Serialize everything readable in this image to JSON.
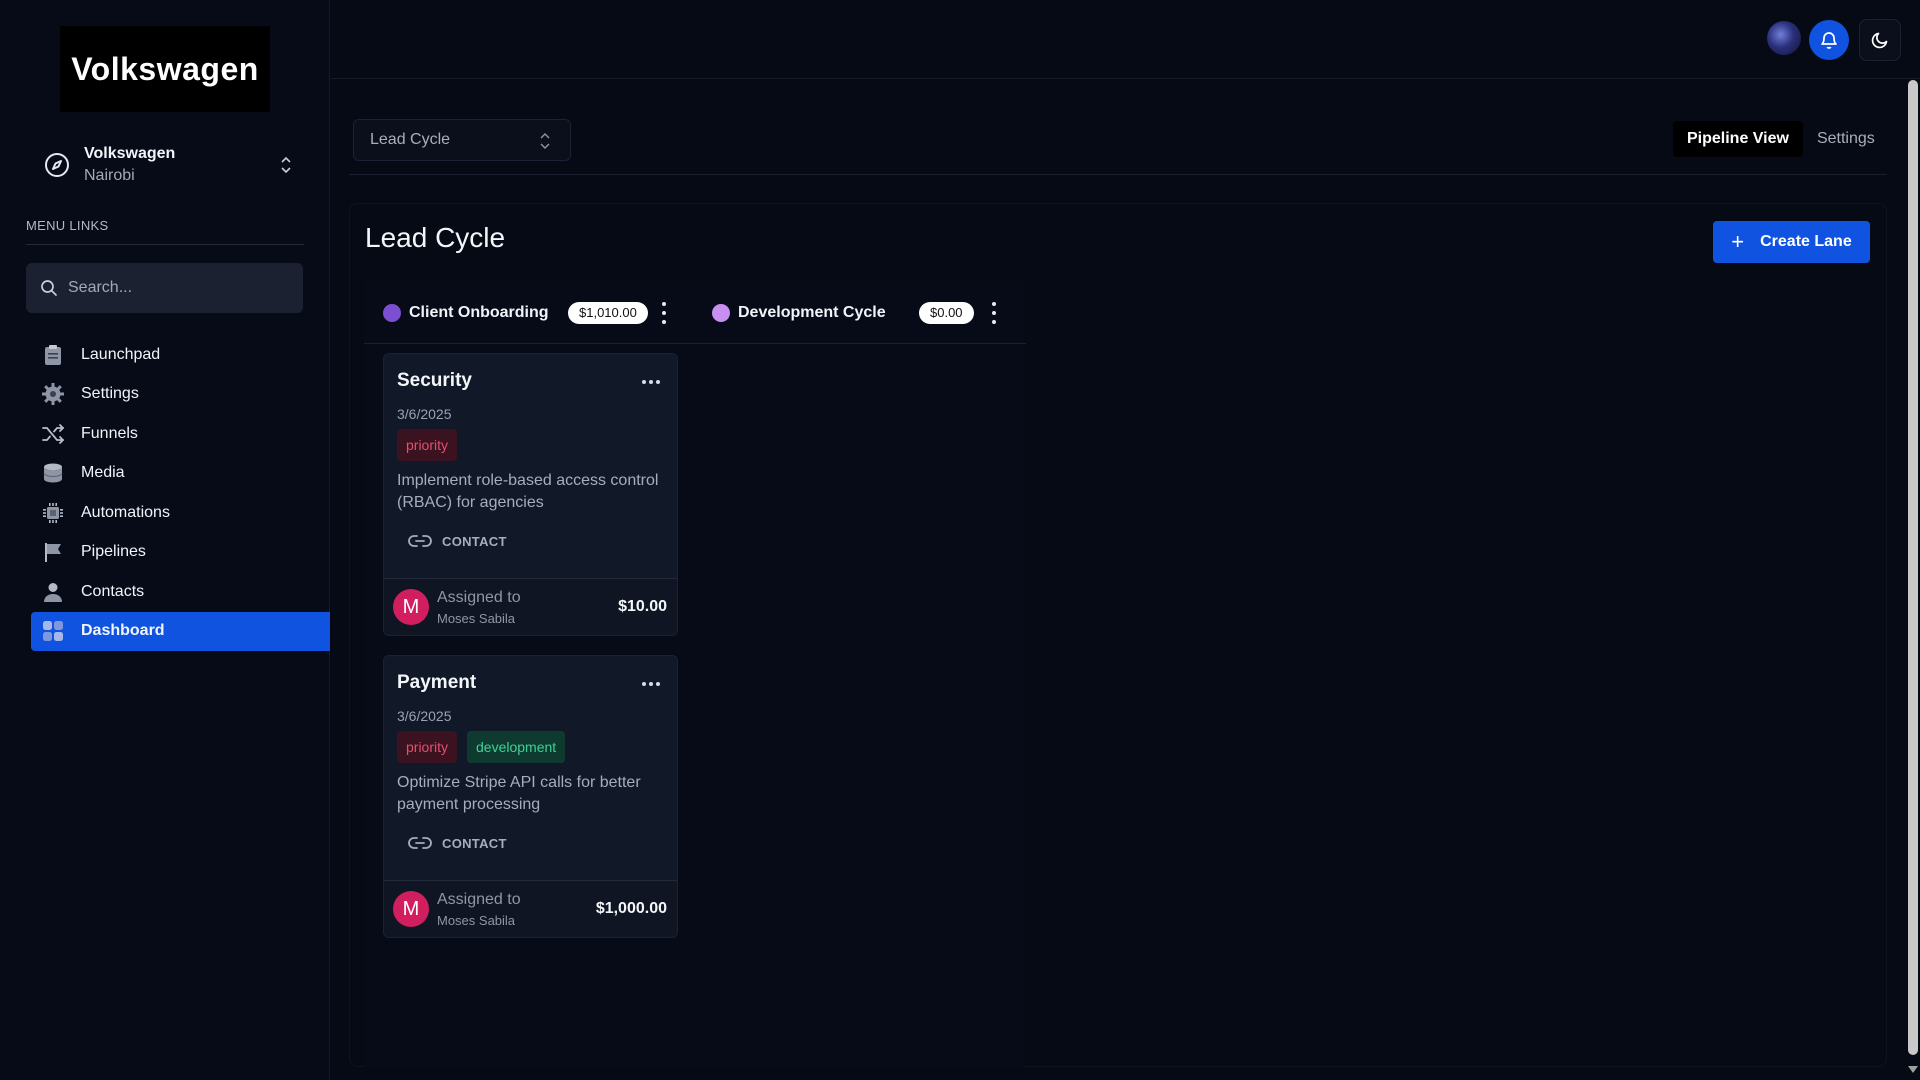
{
  "brand": {
    "logo_text": "Volkswagen"
  },
  "agency": {
    "name": "Volkswagen",
    "location": "Nairobi"
  },
  "sidebar": {
    "menu_title": "MENU LINKS",
    "search_placeholder": "Search...",
    "items": [
      {
        "label": "Launchpad",
        "icon": "clipboard-icon"
      },
      {
        "label": "Settings",
        "icon": "gear-icon"
      },
      {
        "label": "Funnels",
        "icon": "shuffle-icon"
      },
      {
        "label": "Media",
        "icon": "database-icon"
      },
      {
        "label": "Automations",
        "icon": "chip-icon"
      },
      {
        "label": "Pipelines",
        "icon": "flag-icon"
      },
      {
        "label": "Contacts",
        "icon": "person-icon"
      },
      {
        "label": "Dashboard",
        "icon": "grid-icon",
        "active": true
      }
    ]
  },
  "header": {
    "pipeline_select": "Lead Cycle",
    "tabs": [
      {
        "label": "Pipeline View",
        "active": true
      },
      {
        "label": "Settings"
      }
    ]
  },
  "board": {
    "title": "Lead Cycle",
    "create_lane_label": "Create Lane",
    "lanes": [
      {
        "name": "Client Onboarding",
        "amount": "$1,010.00",
        "color": "#7c4fd0"
      },
      {
        "name": "Development Cycle",
        "amount": "$0.00",
        "color": "#c98ff0"
      }
    ],
    "tickets": [
      {
        "title": "Security",
        "date": "3/6/2025",
        "tags": [
          "priority"
        ],
        "description": "Implement role-based access control (RBAC) for agencies",
        "contact_label": "CONTACT",
        "assigned_label": "Assigned to",
        "assignee": "Moses Sabila",
        "assignee_initial": "M",
        "value": "$10.00"
      },
      {
        "title": "Payment",
        "date": "3/6/2025",
        "tags": [
          "priority",
          "development"
        ],
        "description": "Optimize Stripe API calls for better payment processing",
        "contact_label": "CONTACT",
        "assigned_label": "Assigned to",
        "assignee": "Moses Sabila",
        "assignee_initial": "M",
        "value": "$1,000.00"
      }
    ]
  },
  "colors": {
    "accent": "#1053e0",
    "background": "#060a15",
    "priority": "#e64f70",
    "development": "#3fd19b"
  }
}
